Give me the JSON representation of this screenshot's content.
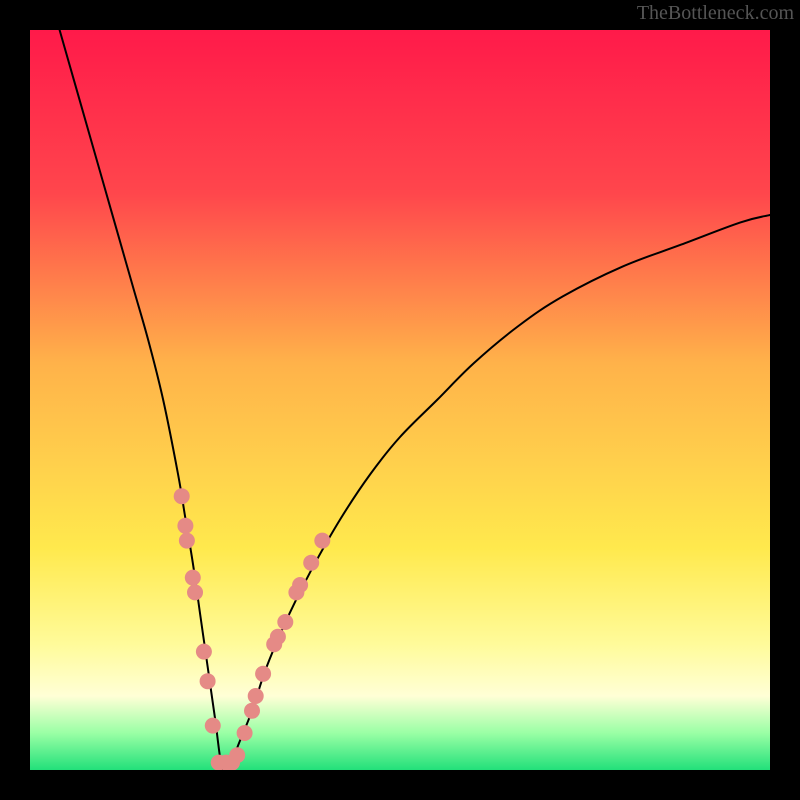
{
  "watermark": {
    "text": "TheBottleneck.com"
  },
  "chart_data": {
    "type": "line",
    "title": "",
    "xlabel": "",
    "ylabel": "",
    "xlim": [
      0,
      100
    ],
    "ylim": [
      0,
      100
    ],
    "grid": false,
    "legend": "none",
    "background_gradient": {
      "stops": [
        {
          "offset": 0.0,
          "color": "#ff1a4a"
        },
        {
          "offset": 0.22,
          "color": "#ff464c"
        },
        {
          "offset": 0.45,
          "color": "#ffb24a"
        },
        {
          "offset": 0.7,
          "color": "#ffe94d"
        },
        {
          "offset": 0.83,
          "color": "#fffb9a"
        },
        {
          "offset": 0.9,
          "color": "#ffffd6"
        },
        {
          "offset": 0.95,
          "color": "#9affa5"
        },
        {
          "offset": 1.0,
          "color": "#22e07a"
        }
      ]
    },
    "series": [
      {
        "name": "bottleneck-curve",
        "x": [
          4,
          6,
          8,
          10,
          12,
          14,
          16,
          18,
          20,
          21,
          22,
          23,
          24,
          25,
          26,
          27,
          28,
          30,
          32,
          35,
          38,
          42,
          46,
          50,
          55,
          60,
          66,
          72,
          80,
          88,
          96,
          100
        ],
        "y": [
          100,
          93,
          86,
          79,
          72,
          65,
          58,
          50,
          40,
          34,
          28,
          21,
          14,
          7,
          0,
          0,
          3,
          8,
          14,
          21,
          27,
          34,
          40,
          45,
          50,
          55,
          60,
          64,
          68,
          71,
          74,
          75
        ],
        "color": "#000000",
        "line_width": 2
      }
    ],
    "markers": [
      {
        "x": 20.5,
        "y": 37,
        "color": "#e58a86"
      },
      {
        "x": 21.0,
        "y": 33,
        "color": "#e58a86"
      },
      {
        "x": 21.2,
        "y": 31,
        "color": "#e58a86"
      },
      {
        "x": 22.0,
        "y": 26,
        "color": "#e58a86"
      },
      {
        "x": 22.3,
        "y": 24,
        "color": "#e58a86"
      },
      {
        "x": 23.5,
        "y": 16,
        "color": "#e58a86"
      },
      {
        "x": 24.0,
        "y": 12,
        "color": "#e58a86"
      },
      {
        "x": 24.7,
        "y": 6,
        "color": "#e58a86"
      },
      {
        "x": 25.5,
        "y": 1,
        "color": "#e58a86"
      },
      {
        "x": 26.5,
        "y": 1,
        "color": "#e58a86"
      },
      {
        "x": 27.3,
        "y": 1,
        "color": "#e58a86"
      },
      {
        "x": 28.0,
        "y": 2,
        "color": "#e58a86"
      },
      {
        "x": 29.0,
        "y": 5,
        "color": "#e58a86"
      },
      {
        "x": 30.0,
        "y": 8,
        "color": "#e58a86"
      },
      {
        "x": 30.5,
        "y": 10,
        "color": "#e58a86"
      },
      {
        "x": 31.5,
        "y": 13,
        "color": "#e58a86"
      },
      {
        "x": 33.0,
        "y": 17,
        "color": "#e58a86"
      },
      {
        "x": 33.5,
        "y": 18,
        "color": "#e58a86"
      },
      {
        "x": 34.5,
        "y": 20,
        "color": "#e58a86"
      },
      {
        "x": 36.0,
        "y": 24,
        "color": "#e58a86"
      },
      {
        "x": 36.5,
        "y": 25,
        "color": "#e58a86"
      },
      {
        "x": 38.0,
        "y": 28,
        "color": "#e58a86"
      },
      {
        "x": 39.5,
        "y": 31,
        "color": "#e58a86"
      }
    ],
    "marker_radius": 8
  }
}
